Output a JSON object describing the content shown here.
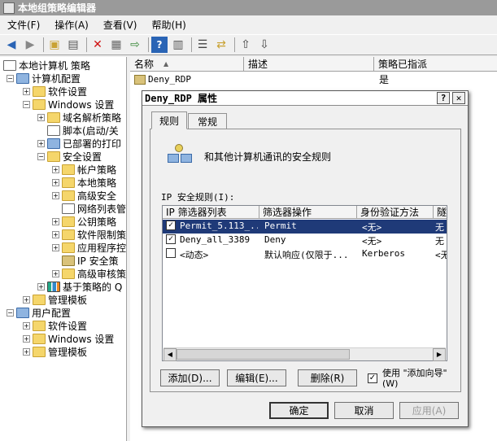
{
  "window": {
    "title": "本地组策略编辑器"
  },
  "menu": [
    "文件(F)",
    "操作(A)",
    "查看(V)",
    "帮助(H)"
  ],
  "tree": {
    "root": "本地计算机 策略",
    "computer_config": "计算机配置",
    "software_settings": "软件设置",
    "windows_settings": "Windows 设置",
    "name_resolution": "域名解析策略",
    "scripts": "脚本(启动/关",
    "deployed_printers": "已部署的打印",
    "security_settings": "安全设置",
    "account_policies": "帐户策略",
    "local_policies": "本地策略",
    "advanced_security": "高级安全",
    "network_list": "网络列表管",
    "public_key": "公钥策略",
    "software_restriction": "软件限制策",
    "app_control": "应用程序控",
    "ip_security": "IP 安全策",
    "advanced_audit": "高级审核策",
    "qos": "基于策略的 Q",
    "admin_templates": "管理模板",
    "user_config": "用户配置",
    "user_software": "软件设置",
    "user_windows": "Windows 设置",
    "user_admin": "管理模板"
  },
  "list": {
    "headers": {
      "name": "名称",
      "desc": "描述",
      "assigned": "策略已指派"
    },
    "row": {
      "name": "Deny_RDP",
      "desc": "",
      "assigned": "是"
    }
  },
  "dialog": {
    "title": "Deny_RDP 属性",
    "help_btn": "?",
    "close_btn": "✕",
    "tabs": [
      "规则",
      "常规"
    ],
    "description": "和其他计算机通讯的安全规则",
    "rules_label": "IP 安全规则(I):",
    "columns": {
      "ip_filter": "IP 筛选器列表",
      "filter_action": "筛选器操作",
      "auth": "身份验证方法",
      "tunnel": "隧"
    },
    "rules": [
      {
        "checked": true,
        "filter": "Permit_5.113_...",
        "action": "Permit",
        "auth": "<无>",
        "tunnel": "无"
      },
      {
        "checked": true,
        "filter": "Deny_all_3389",
        "action": "Deny",
        "auth": "<无>",
        "tunnel": "无"
      },
      {
        "checked": false,
        "filter": "<动态>",
        "action": "默认响应(仅限于...",
        "auth": "Kerberos",
        "tunnel": "<无"
      }
    ],
    "add_btn": "添加(D)...",
    "edit_btn": "编辑(E)...",
    "remove_btn": "删除(R)",
    "use_wizard": {
      "checked": true,
      "text": "使用 \"添加向导\"(W)"
    },
    "ok": "确定",
    "cancel": "取消",
    "apply": "应用(A)"
  }
}
